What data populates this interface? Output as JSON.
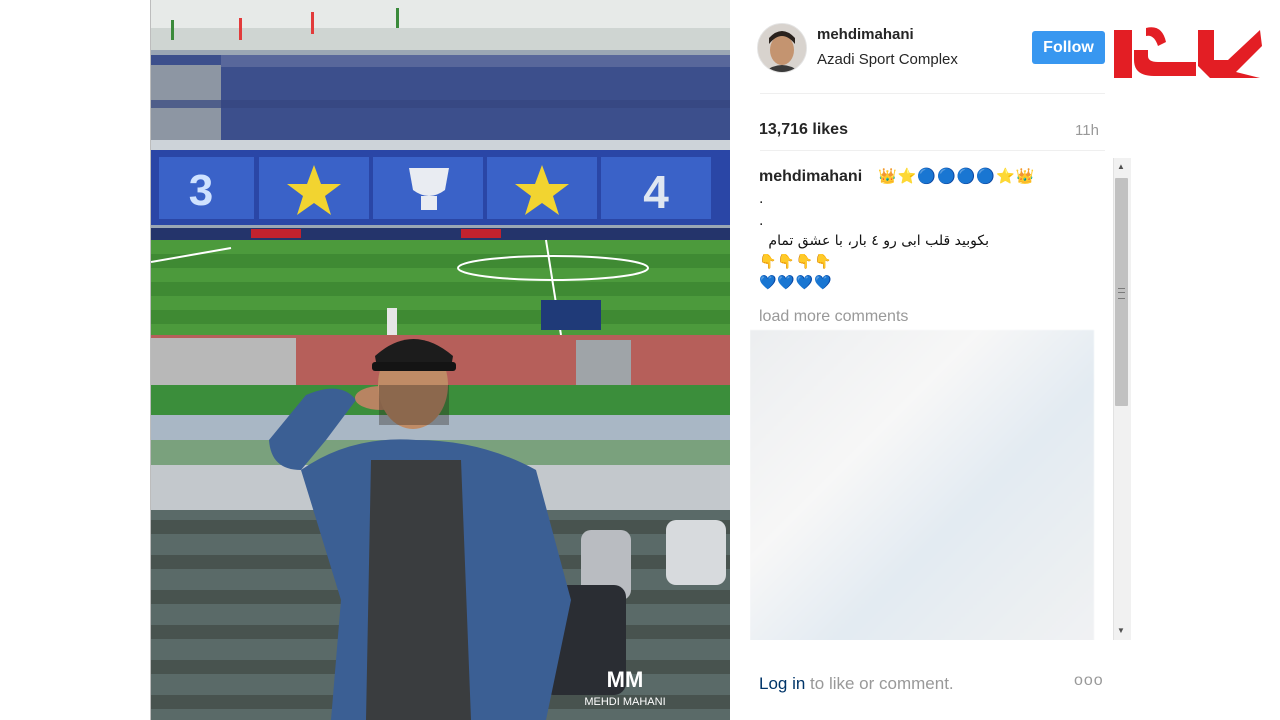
{
  "post": {
    "photo_alt": "Stadium selfie",
    "watermark": "MEHDI MAHANI",
    "watermark_mark": "MM"
  },
  "header": {
    "username": "mehdimahani",
    "location": "Azadi Sport Complex",
    "follow_label": "Follow"
  },
  "stats": {
    "likes": "13,716 likes",
    "time_ago": "11h"
  },
  "caption": {
    "username": "mehdimahani",
    "emoji_line": "👑⭐🔵🔵🔵🔵⭐👑",
    "dot1": ".",
    "dot2": ".",
    "text": "بکوبید قلب ابی رو ٤ بار، با عشق تمام",
    "hands": "👇👇👇👇",
    "hearts": "💙💙💙💙"
  },
  "comments": {
    "load_more": "load more comments"
  },
  "footer": {
    "login_link": "Log in",
    "login_rest": " to like or comment.",
    "more_options": "ooo"
  },
  "colors": {
    "follow_button": "#3897f0",
    "logo_red": "#e31e24",
    "stands_blue": "#2b4aa0",
    "pitch_green": "#3f8a33"
  }
}
